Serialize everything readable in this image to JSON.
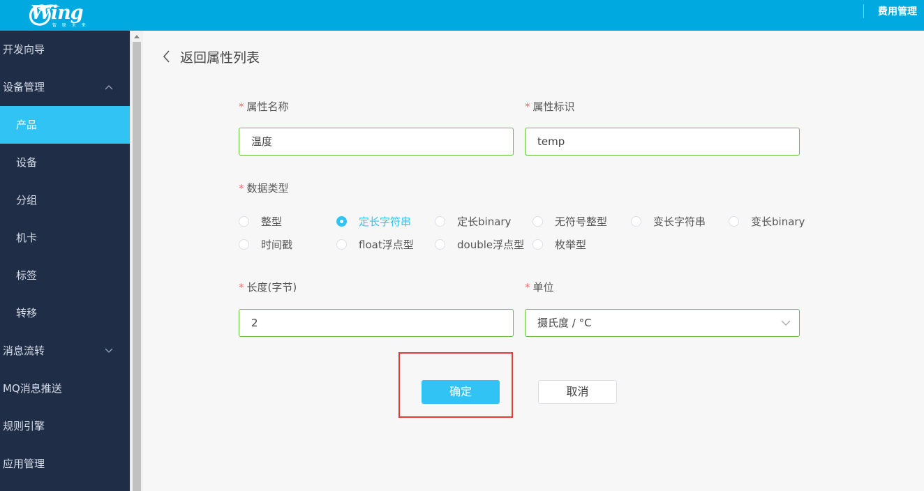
{
  "header": {
    "logo_text": "Wing",
    "logo_sub": "智 联 未 来",
    "nav_right": "费用管理"
  },
  "sidebar": {
    "items": [
      {
        "label": "开发向导",
        "level": 1
      },
      {
        "label": "设备管理",
        "level": 1,
        "chevron": "chevron-up-icon"
      },
      {
        "label": "产品",
        "level": 2,
        "active": true
      },
      {
        "label": "设备",
        "level": 2
      },
      {
        "label": "分组",
        "level": 2
      },
      {
        "label": "机卡",
        "level": 2
      },
      {
        "label": "标签",
        "level": 2
      },
      {
        "label": "转移",
        "level": 2
      },
      {
        "label": "消息流转",
        "level": 1,
        "chevron": "chevron-down-icon"
      },
      {
        "label": "MQ消息推送",
        "level": 1
      },
      {
        "label": "规则引擎",
        "level": 1
      },
      {
        "label": "应用管理",
        "level": 1
      }
    ]
  },
  "main": {
    "back_label": "返回属性列表",
    "required_mark": "*",
    "fields": {
      "name": {
        "label": "属性名称",
        "value": "温度"
      },
      "identifier": {
        "label": "属性标识",
        "value": "temp"
      },
      "data_type": {
        "label": "数据类型"
      },
      "length": {
        "label": "长度(字节)",
        "value": "2"
      },
      "unit": {
        "label": "单位",
        "value": "摄氏度 / °C"
      }
    },
    "data_type_options": [
      {
        "label": "整型",
        "checked": false
      },
      {
        "label": "定长字符串",
        "checked": true
      },
      {
        "label": "定长binary",
        "checked": false
      },
      {
        "label": "无符号整型",
        "checked": false
      },
      {
        "label": "变长字符串",
        "checked": false
      },
      {
        "label": "变长binary",
        "checked": false
      },
      {
        "label": "时间戳",
        "checked": false
      },
      {
        "label": "float浮点型",
        "checked": false
      },
      {
        "label": "double浮点型",
        "checked": false
      },
      {
        "label": "枚举型",
        "checked": false
      }
    ],
    "buttons": {
      "confirm": "确定",
      "cancel": "取消"
    }
  },
  "colors": {
    "header_bg": "#00a9e0",
    "sidebar_bg": "#1f2d47",
    "accent": "#30c3f4",
    "valid_border": "#67c23a",
    "required": "#f56c6c",
    "highlight_box": "#e53935"
  }
}
